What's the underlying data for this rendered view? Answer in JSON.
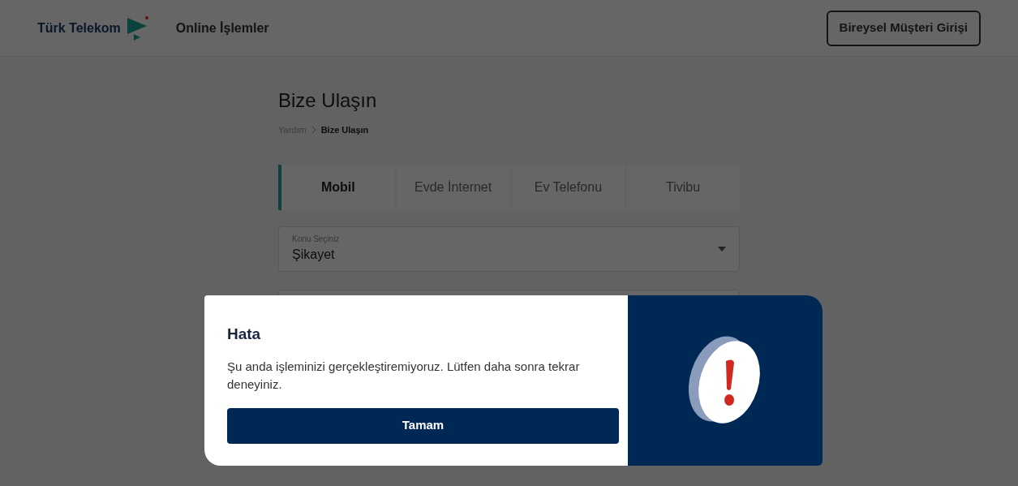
{
  "header": {
    "logo_text": "Türk Telekom",
    "nav_link": "Online İşlemler",
    "login_button": "Bireysel Müşteri Girişi"
  },
  "page": {
    "title": "Bize Ulaşın",
    "breadcrumb": [
      "Yardım",
      "Bize Ulaşın"
    ]
  },
  "tabs": [
    {
      "label": "Mobil",
      "selected": true
    },
    {
      "label": "Evde İnternet",
      "selected": false
    },
    {
      "label": "Ev Telefonu",
      "selected": false
    },
    {
      "label": "Tivibu",
      "selected": false
    }
  ],
  "topic_select": {
    "label": "Konu Seçiniz",
    "value": "Şikayet"
  },
  "dialog": {
    "title": "Hata",
    "message": "Şu anda işleminizi gerçekleştiremiyoruz. Lütfen daha sonra tekrar deneyiniz.",
    "button": "Tamam"
  }
}
